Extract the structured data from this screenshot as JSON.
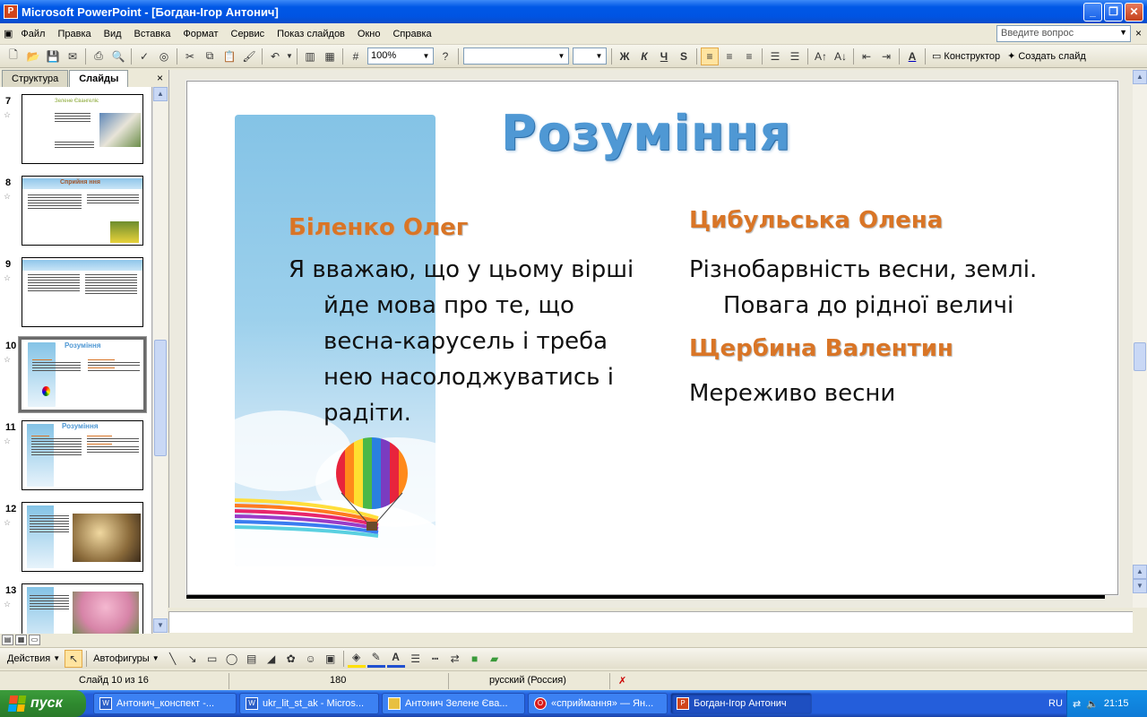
{
  "window": {
    "title": "Microsoft PowerPoint - [Богдан-Ігор Антонич]",
    "icon": "powerpoint-icon",
    "buttons": [
      "_",
      "❐",
      "✕"
    ]
  },
  "menu": [
    "Файл",
    "Правка",
    "Вид",
    "Вставка",
    "Формат",
    "Сервис",
    "Показ слайдов",
    "Окно",
    "Справка"
  ],
  "help": {
    "placeholder": "Введите вопрос"
  },
  "toolbar": {
    "zoom": "100%",
    "bold": "Ж",
    "italic": "К",
    "underline": "Ч",
    "shadow": "S",
    "designer": "Конструктор",
    "new_slide": "Создать слайд"
  },
  "panel_tabs": {
    "outline": "Структура",
    "slides": "Слайды",
    "close": "×"
  },
  "thumbnails": [
    {
      "num": "7",
      "title": "Зелене Євангеліє"
    },
    {
      "num": "8",
      "title": "Сприйня ння"
    },
    {
      "num": "9",
      "title": ""
    },
    {
      "num": "10",
      "title": "Розуміння"
    },
    {
      "num": "11",
      "title": "Розуміння"
    },
    {
      "num": "12",
      "title": ""
    },
    {
      "num": "13",
      "title": ""
    }
  ],
  "slide": {
    "title": "Розуміння",
    "left": {
      "name": "Біленко Олег",
      "first_line": "Я вважаю, що у цьому вірші",
      "lines": [
        "йде мова про те, що",
        "весна-карусель і треба",
        "нею насолоджуватись і",
        "радіти."
      ]
    },
    "right1": {
      "name": "Цибульська Олена",
      "line1": "Різнобарвність весни, землі.",
      "line2": "Повага до рідної величі"
    },
    "right2": {
      "name": "Щербина Валентин",
      "line1": "Мереживо весни"
    }
  },
  "drawbar": {
    "actions": "Действия",
    "autoshapes": "Автофигуры"
  },
  "status": {
    "slide": "Слайд 10 из 16",
    "design": "180",
    "language": "русский (Россия)"
  },
  "taskbar": {
    "start": "пуск",
    "tasks": [
      "Антонич_конспект -...",
      "ukr_lit_st_ak - Micros...",
      "Антонич Зелене Єва...",
      "«сприймання» — Ян...",
      "Богдан-Ігор Антонич"
    ],
    "lang": "RU",
    "time": "21:15"
  }
}
